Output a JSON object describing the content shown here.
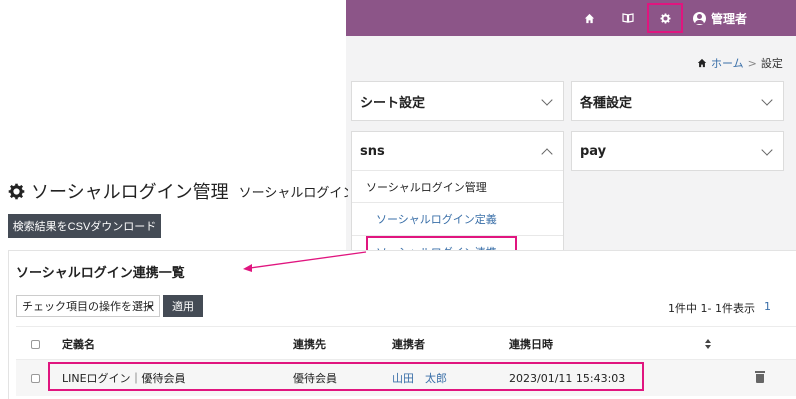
{
  "header": {
    "user_name": "管理者",
    "nav_icons": [
      "home-icon",
      "book-icon",
      "gear-icon",
      "user-icon"
    ]
  },
  "breadcrumb": {
    "home": "ホーム",
    "separator": ">",
    "current": "設定"
  },
  "settings": {
    "sheet": "シート設定",
    "various": "各種設定",
    "sns": "sns",
    "pay": "pay",
    "sns_items": [
      "ソーシャルログイン管理",
      "ソーシャルログイン定義",
      "ソーシャルログイン連携"
    ]
  },
  "page": {
    "title": "ソーシャルログイン管理",
    "subtitle": "ソーシャルログイン連携",
    "csv_button": "検索結果をCSVダウンロード",
    "list_title": "ソーシャルログイン連携一覧",
    "bulk_select": "チェック項目の操作を選択",
    "apply": "適用",
    "paging": "1件中 1- 1件表示",
    "page_num": "1"
  },
  "table": {
    "columns": [
      "定義名",
      "連携先",
      "連携者",
      "連携日時"
    ],
    "rows": [
      {
        "definition": "LINEログイン｜優待会員",
        "target": "優待会員",
        "user": "山田　太郎",
        "datetime": "2023/01/11 15:43:03"
      }
    ]
  },
  "colors": {
    "header_bg": "#8c5588",
    "highlight": "#e0157f",
    "link": "#3a6fa8",
    "button_bg": "#444b55"
  }
}
